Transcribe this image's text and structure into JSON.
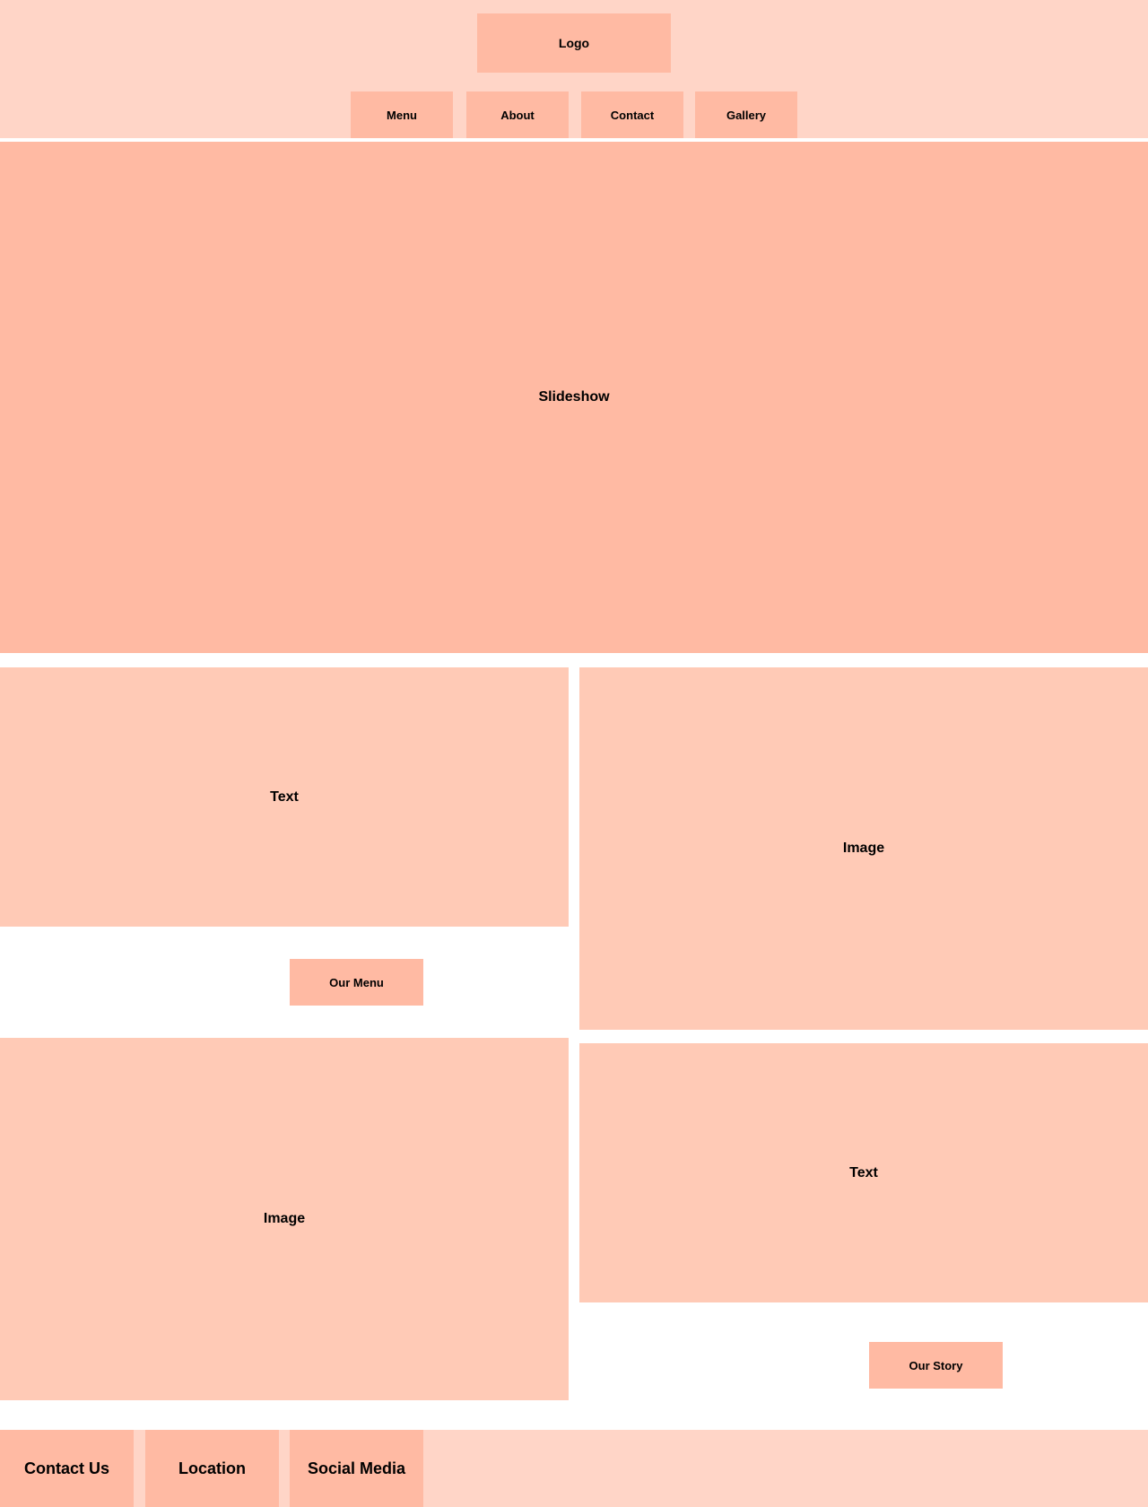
{
  "colors": {
    "header_bg": "#ffd5c7",
    "accent": "#ffbaa3",
    "block": "#ffcab6",
    "footer_bg": "#ffd5c7",
    "page_bg": "#ffffff",
    "text": "#000000"
  },
  "header": {
    "logo": "Logo",
    "nav": [
      {
        "label": "Menu"
      },
      {
        "label": "About"
      },
      {
        "label": "Contact"
      },
      {
        "label": "Gallery"
      }
    ]
  },
  "hero": {
    "label": "Slideshow"
  },
  "sections": {
    "row1_text": "Text",
    "row1_image": "Image",
    "row1_button": "Our Menu",
    "row2_image": "Image",
    "row2_text": "Text",
    "row2_button": "Our Story"
  },
  "footer": {
    "items": [
      {
        "label": "Contact Us"
      },
      {
        "label": "Location"
      },
      {
        "label": "Social Media"
      }
    ]
  }
}
